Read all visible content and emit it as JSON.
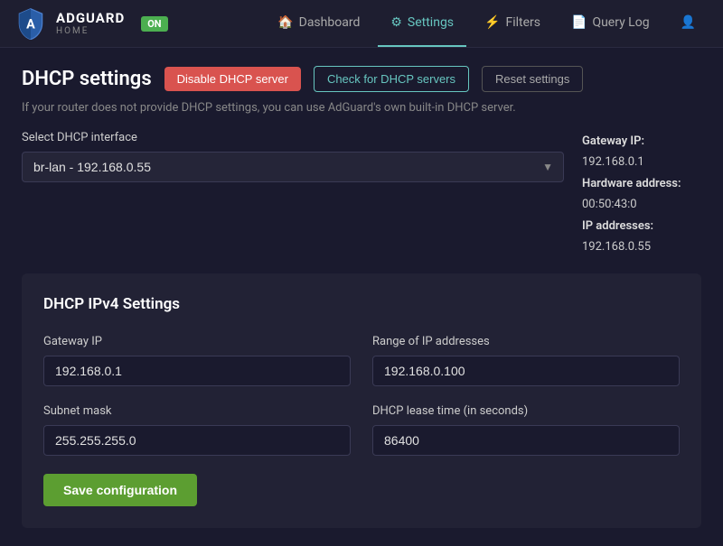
{
  "navbar": {
    "brand_name": "ADGUARD",
    "brand_sub": "HOME",
    "status_label": "ON",
    "nav_items": [
      {
        "label": "Dashboard",
        "icon": "🏠",
        "active": false
      },
      {
        "label": "Settings",
        "icon": "⚙",
        "active": true
      },
      {
        "label": "Filters",
        "icon": "⚡",
        "active": false
      },
      {
        "label": "Query Log",
        "icon": "📄",
        "active": false
      }
    ]
  },
  "page": {
    "title": "DHCP settings",
    "btn_disable": "Disable DHCP server",
    "btn_check": "Check for DHCP servers",
    "btn_reset": "Reset settings",
    "subtitle": "If your router does not provide DHCP settings, you can use AdGuard's own built-in DHCP server.",
    "interface_label": "Select DHCP interface",
    "interface_value": "br-lan - 192.168.0.55",
    "gateway_ip_label": "Gateway IP:",
    "gateway_ip_value": "192.168.0.1",
    "hardware_address_label": "Hardware address:",
    "hardware_address_value": "00:50:43:0",
    "ip_addresses_label": "IP addresses:",
    "ip_addresses_value": "192.168.0.55",
    "card_title": "DHCP IPv4 Settings",
    "form": {
      "gateway_ip_label": "Gateway IP",
      "gateway_ip_value": "192.168.0.1",
      "range_label": "Range of IP addresses",
      "range_value": "192.168.0.100",
      "subnet_label": "Subnet mask",
      "subnet_value": "255.255.255.0",
      "lease_label": "DHCP lease time (in seconds)",
      "lease_value": "86400",
      "save_label": "Save configuration"
    }
  }
}
